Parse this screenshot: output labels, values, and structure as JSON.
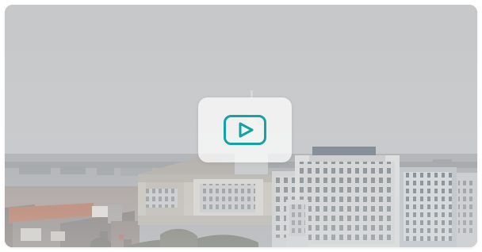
{
  "video": {
    "thumbnail_subject": "city-skyline-icon",
    "play_button_icon": "play-icon",
    "accent_color": "#14a3a3"
  }
}
